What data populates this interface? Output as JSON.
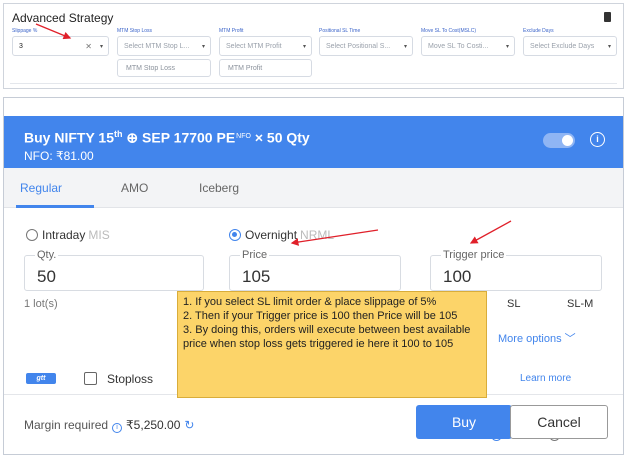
{
  "top_panel": {
    "title": "Advanced Strategy",
    "slippage": {
      "label": "Slippage %",
      "value": "3",
      "clear": "✕",
      "caret": "▾"
    },
    "mtm_stop_loss": {
      "label": "MTM Stop Loss",
      "placeholder": "Select MTM Stop L...",
      "input": "MTM Stop Loss"
    },
    "mtm_profit": {
      "label": "MTM Profit",
      "placeholder": "Select MTM Profit",
      "input": "MTM Profit"
    },
    "positional_sl_time": {
      "label": "Positional SL Time",
      "placeholder": "Select Positional S..."
    },
    "move_sl_to_cost": {
      "label": "Move SL To Cost(MSLC)",
      "placeholder": "Move SL To Costi..."
    },
    "exclude_days": {
      "label": "Exclude Days",
      "placeholder": "Select Exclude Days"
    }
  },
  "order": {
    "title_prefix": "Buy  NIFTY 15",
    "title_sup": "th",
    "title_icon": "⊕",
    "title_rest": " SEP 17700 PE",
    "title_exchange": "NFO",
    "title_qty": " × 50 Qty",
    "subtitle": "NFO: ₹81.00",
    "info_glyph": "i",
    "tabs": [
      "Regular",
      "AMO",
      "Iceberg"
    ],
    "product": [
      {
        "label": "Intraday",
        "code": "MIS"
      },
      {
        "label": "Overnight",
        "code": "NRML"
      }
    ],
    "qty": {
      "label": "Qty.",
      "value": "50"
    },
    "price": {
      "label": "Price",
      "value": "105"
    },
    "trigger": {
      "label": "Trigger price",
      "value": "100"
    },
    "lots": "1 lot(s)",
    "order_types": [
      "SL",
      "SL-M"
    ],
    "more_options": "More options ﹀",
    "gtt": "gtt",
    "stoploss": "Stoploss",
    "learn_more": "Learn more",
    "margin_label": "Margin required",
    "margin_value": "₹5,250.00",
    "margin_refresh": "↻",
    "buy": "Buy",
    "cancel": "Cancel"
  },
  "note": {
    "lines": [
      "1. If you select SL limit order & place slippage of 5%",
      "2. Then if your Trigger price is 100 then Price will be 105",
      "3. By doing this, orders will execute between best available price when stop loss gets triggered ie here it 100 to 105"
    ]
  },
  "colors": {
    "accent": "#4285ec",
    "note_bg": "#fcd469",
    "arrow": "#e0202a"
  }
}
